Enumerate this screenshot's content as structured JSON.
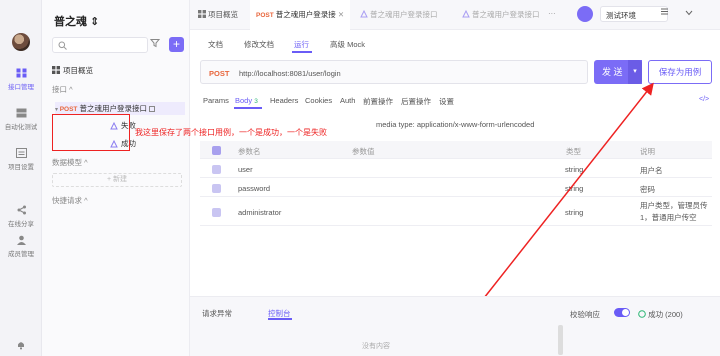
{
  "rail": {
    "items": [
      {
        "label": "接口管理"
      },
      {
        "label": "自动化测试"
      },
      {
        "label": "项目设置"
      },
      {
        "label": "在线分享"
      },
      {
        "label": "成员管理"
      }
    ]
  },
  "project": {
    "title": "普之魂 ⇕",
    "overview": "项目概览",
    "section_api": "接口 ^",
    "endpoint_method": "POST",
    "endpoint_name": "普之魂用户登录接口",
    "cases": [
      {
        "label": "失败"
      },
      {
        "label": "成功"
      }
    ],
    "section_models": "数据模型 ^",
    "new_label": "+ 新建",
    "section_quick": "快捷请求 ^"
  },
  "tabs": [
    {
      "label": "项目概览"
    },
    {
      "method": "POST",
      "label": "普之魂用户登录接"
    },
    {
      "label": "普之魂用户登录接口"
    },
    {
      "label": "普之魂用户登录接口"
    }
  ],
  "env": {
    "selected": "测试环境"
  },
  "subtabs": [
    "文档",
    "修改文档",
    "运行",
    "高级 Mock"
  ],
  "request": {
    "method": "POST",
    "url": "http://localhost:8081/user/login",
    "send_label": "发 送",
    "save_label": "保存为用例"
  },
  "param_tabs": [
    "Params",
    "Body",
    "Headers",
    "Cookies",
    "Auth",
    "前置操作",
    "后置操作",
    "设置"
  ],
  "body_count": "3",
  "code_icon_text": "</>",
  "media_type": "media type: application/x-www-form-urlencoded",
  "table": {
    "headers": [
      "参数名",
      "参数值",
      "类型",
      "说明"
    ],
    "rows": [
      {
        "name": "user",
        "type": "string",
        "desc": "用户名"
      },
      {
        "name": "password",
        "type": "string",
        "desc": "密码"
      },
      {
        "name": "administrator",
        "type": "string",
        "desc": "用户类型，管理员传1，普通用户传空"
      }
    ]
  },
  "annotation": "我这里保存了两个接口用例，一个是成功，一个是失败",
  "bottom": {
    "tabs": [
      "请求异常",
      "控制台"
    ],
    "empty": "没有内容",
    "validate_label": "校验响应",
    "status": "成功 (200)"
  },
  "colors": {
    "accent": "#7b6cf6",
    "post": "#e8663c",
    "annotation": "#e22222"
  }
}
